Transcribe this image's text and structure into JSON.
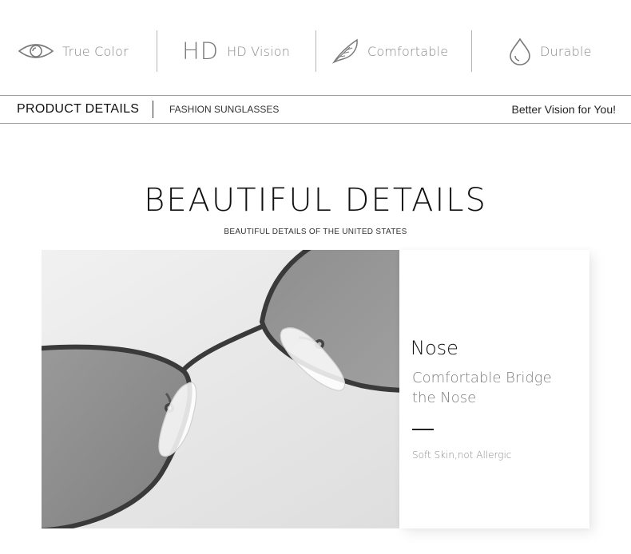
{
  "features": [
    {
      "icon": "eye-icon",
      "label": "True Color"
    },
    {
      "icon": "hd-icon",
      "glyph": "HD",
      "label": "HD Vision"
    },
    {
      "icon": "feather-icon",
      "label": "Comfortable"
    },
    {
      "icon": "water-drop-icon",
      "label": "Durable"
    }
  ],
  "details_bar": {
    "title": "PRODUCT DETAILS",
    "subtitle": "FASHION SUNGLASSES",
    "tagline": "Better Vision for You!"
  },
  "section": {
    "heading": "BEAUTIFUL DETAILS",
    "subheading": "BEAUTIFUL DETAILS OF THE UNITED STATES"
  },
  "detail_card": {
    "title": "Nose",
    "description_line1": "Comfortable Bridge",
    "description_line2": "the Nose",
    "note": "Soft Skin,not Allergic"
  },
  "colors": {
    "icon_gray": "#7a7a7a",
    "label_gray": "#8a8a8a",
    "frame": "#3a3a3a",
    "lens": "#8c8c8c"
  }
}
